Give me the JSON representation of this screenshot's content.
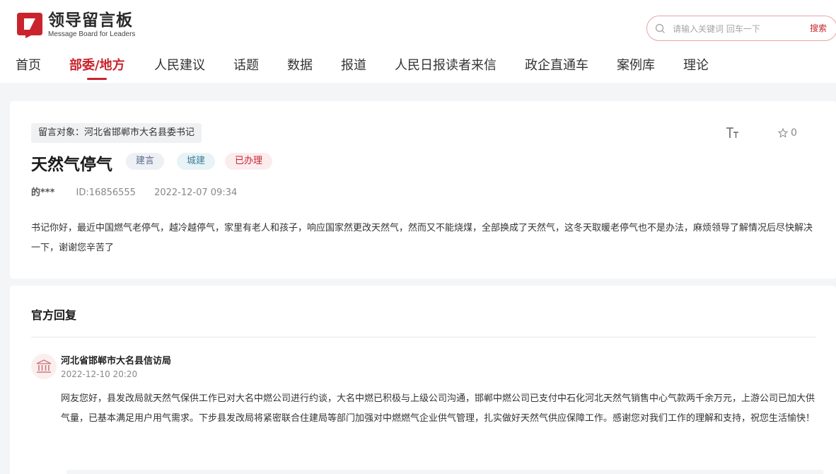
{
  "header": {
    "logo_title": "领导留言板",
    "logo_subtitle": "Message Board for Leaders",
    "brand_color": "#c9242d"
  },
  "search": {
    "placeholder": "请输入关键词 回车一下",
    "button_label": "搜索"
  },
  "nav": {
    "items": [
      {
        "label": "首页"
      },
      {
        "label": "部委/地方",
        "active": true
      },
      {
        "label": "人民建议"
      },
      {
        "label": "话题"
      },
      {
        "label": "数据"
      },
      {
        "label": "报道"
      },
      {
        "label": "人民日报读者来信"
      },
      {
        "label": "政企直通车"
      },
      {
        "label": "案例库"
      },
      {
        "label": "理论"
      }
    ]
  },
  "message": {
    "target": "留言对象：河北省邯郸市大名县委书记",
    "font_size_icon": "Tт",
    "favorite_count": "0",
    "title": "天然气停气",
    "tags": [
      "建言",
      "城建",
      "已办理"
    ],
    "author": "的***",
    "id": "ID:16856555",
    "time": "2022-12-07 09:34",
    "body": "书记你好，最近中国燃气老停气，越冷越停气，家里有老人和孩子，响应国家然更改天然气，然而又不能烧煤，全部换成了天然气，这冬天取暖老停气也不是办法，麻烦领导了解情况后尽快解决一下，谢谢您辛苦了"
  },
  "reply": {
    "heading": "官方回复",
    "org": "河北省邯郸市大名县信访局",
    "time": "2022-12-10 20:20",
    "body": "网友您好，县发改局就天然气保供工作已对大名中燃公司进行约谈，大名中燃已积极与上级公司沟通，邯郸中燃公司已支付中石化河北天然气销售中心气款两千余万元，上游公司已加大供气量，已基本满足用户用气需求。下步县发改局将紧密联合住建局等部门加强对中燃燃气企业供气管理，扎实做好天然气供应保障工作。感谢您对我们工作的理解和支持，祝您生活愉快！"
  }
}
